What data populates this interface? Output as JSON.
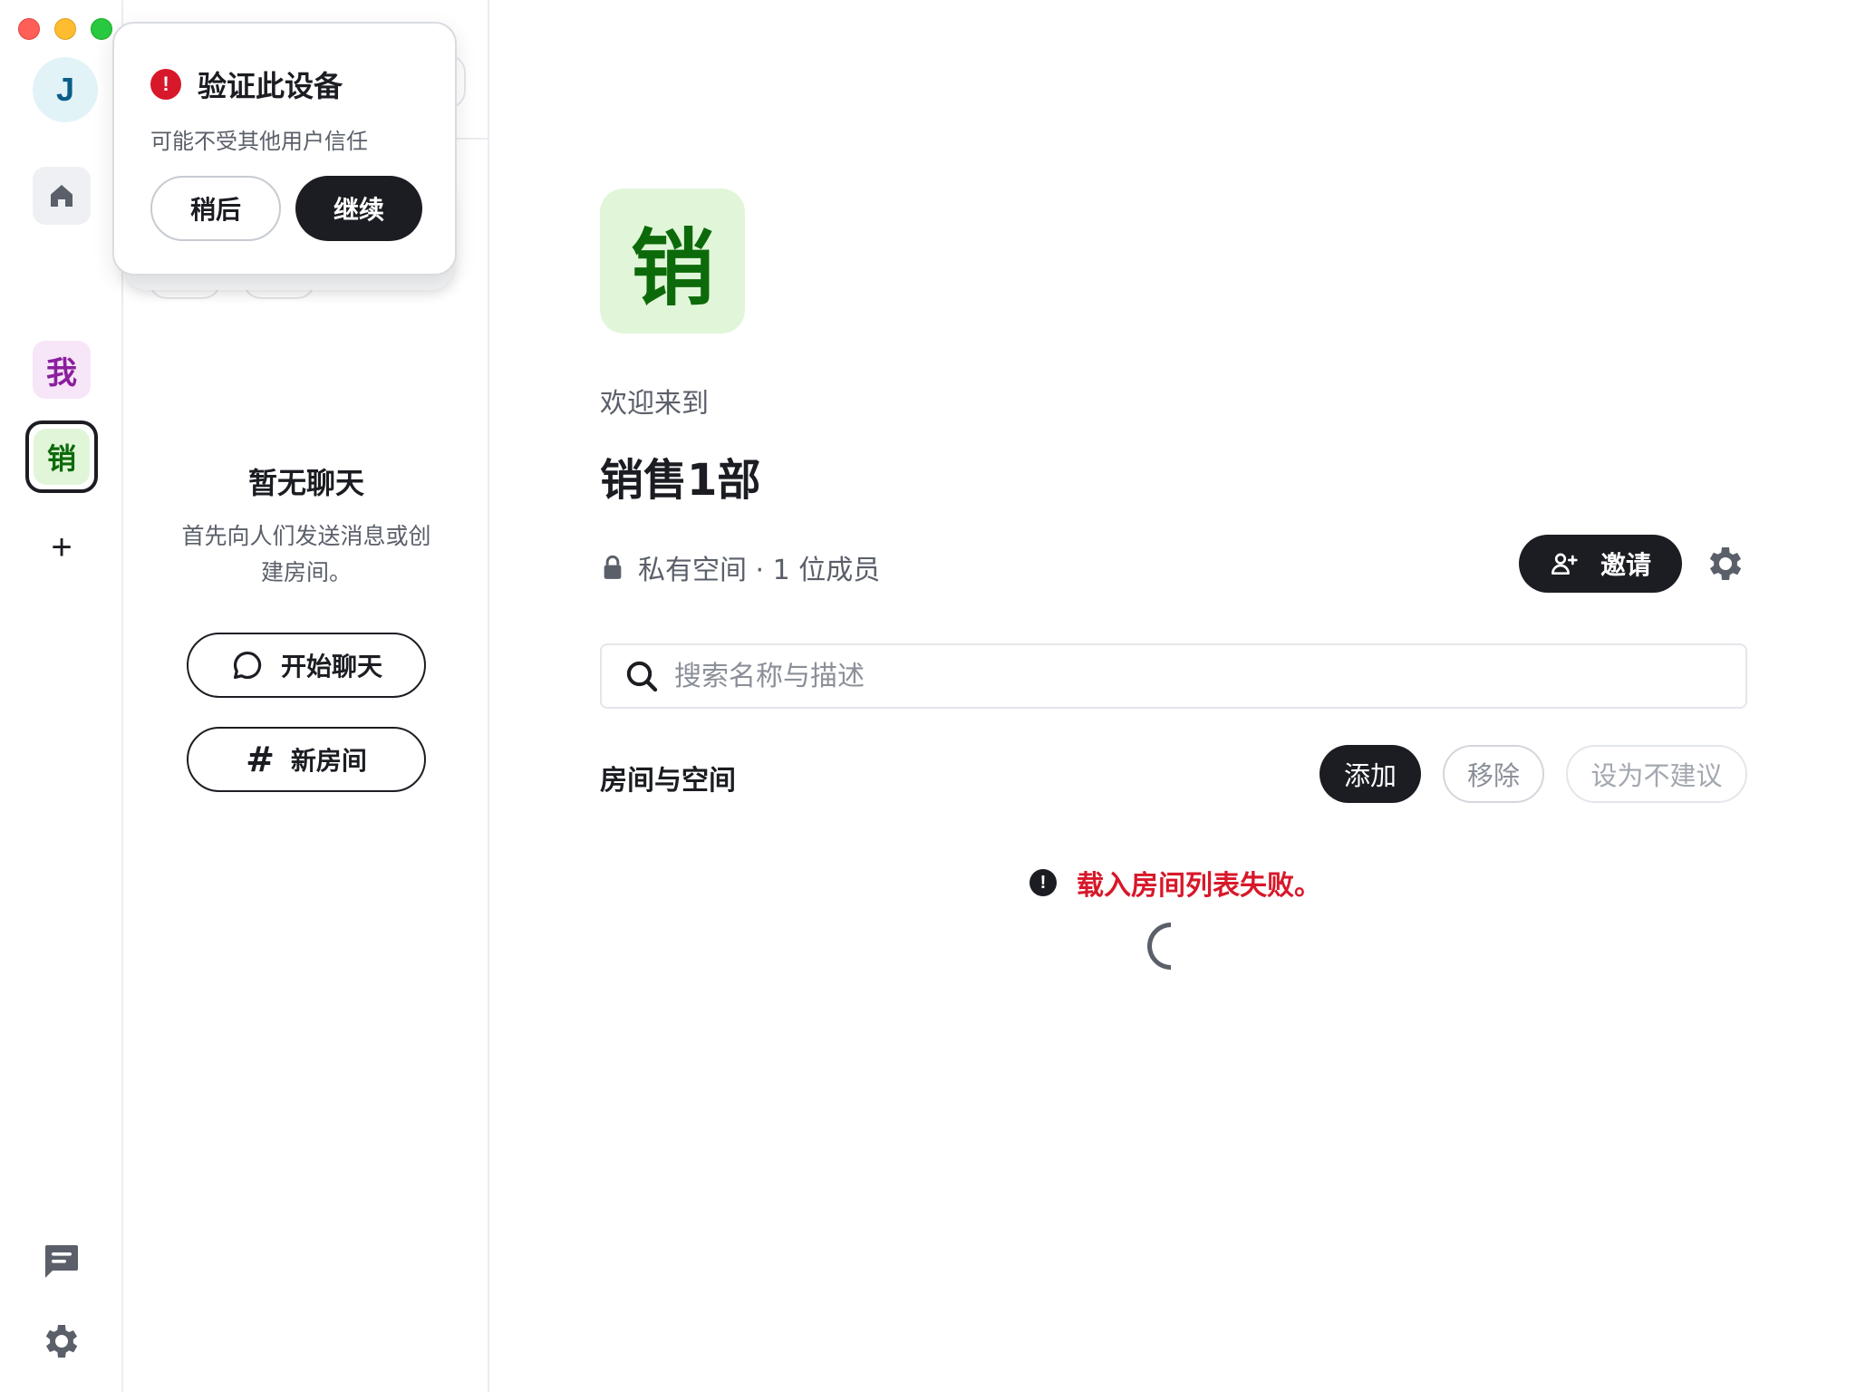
{
  "rail": {
    "user_initial": "J",
    "home_icon": "home-icon",
    "spaces": [
      {
        "label": "我",
        "color": "#8a1f9e",
        "bg": "#f7e6f7"
      },
      {
        "label": "销",
        "color": "#0d6a0a",
        "bg": "#e1f6d9",
        "selected": true
      }
    ],
    "add_label": "+",
    "bottom_icons": [
      "chat-icon",
      "gear-icon"
    ]
  },
  "room_panel": {
    "empty_title": "暂无聊天",
    "empty_desc": "首先向人们发送消息或创建房间。",
    "start_chat_label": "开始聊天",
    "new_room_icon": "#",
    "new_room_label": "新房间"
  },
  "verify_popup": {
    "title": "验证此设备",
    "alert_glyph": "!",
    "description": "可能不受其他用户信任",
    "later_label": "稍后",
    "continue_label": "继续"
  },
  "main": {
    "space_avatar_letter": "销",
    "welcome": "欢迎来到",
    "space_name": "销售1部",
    "meta": "私有空间 · 1 位成员",
    "invite_label": "邀请",
    "search_placeholder": "搜索名称与描述",
    "section_title": "房间与空间",
    "actions": {
      "add": "添加",
      "remove": "移除",
      "unsuggest": "设为不建议"
    },
    "error_glyph": "!",
    "error_text": "载入房间列表失败。"
  },
  "colors": {
    "accent_dark": "#1b1d22",
    "error_red": "#d7182a",
    "space_green_bg": "#e1f6d9",
    "space_green_fg": "#0d6a0a"
  }
}
